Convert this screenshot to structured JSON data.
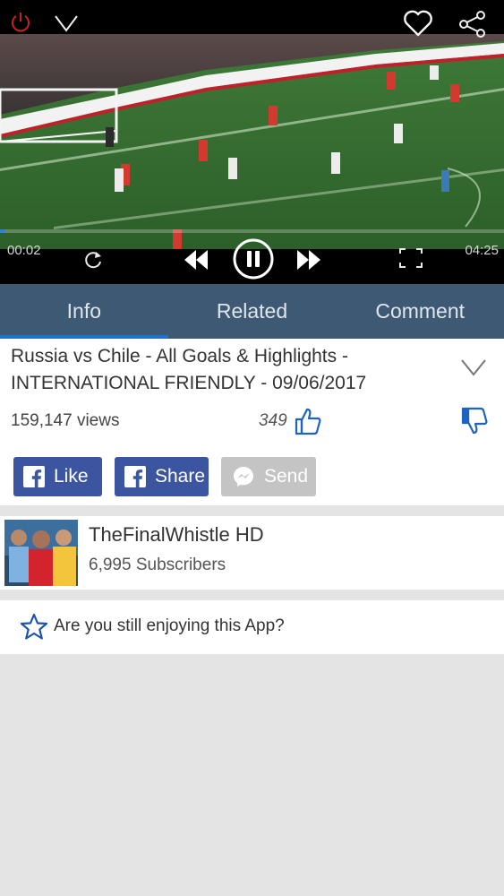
{
  "player": {
    "elapsed": "00:02",
    "total": "04:25",
    "progress_fraction": 0.009,
    "accent_color": "#2f7fe0",
    "icons": [
      "power-icon",
      "chevron-down-icon",
      "heart-icon",
      "share-icon",
      "replay-icon",
      "rewind-icon",
      "pause-icon",
      "fast-forward-icon",
      "fullscreen-icon"
    ]
  },
  "tabs": [
    {
      "label": "Info",
      "active": true
    },
    {
      "label": "Related",
      "active": false
    },
    {
      "label": "Comment",
      "active": false
    }
  ],
  "video": {
    "title": "Russia vs Chile - All Goals & Highlights - INTERNATIONAL FRIENDLY - 09/06/2017",
    "views": "159,147 views",
    "likes": "349"
  },
  "social": {
    "like": "Like",
    "share": "Share",
    "send": "Send",
    "facebook_color": "#3b55a0",
    "send_disabled_color": "#c4c4c4"
  },
  "channel": {
    "name": "TheFinalWhistle HD",
    "subscribers": "6,995 Subscribers"
  },
  "rate": {
    "prompt": "Are you still enjoying this App?"
  }
}
